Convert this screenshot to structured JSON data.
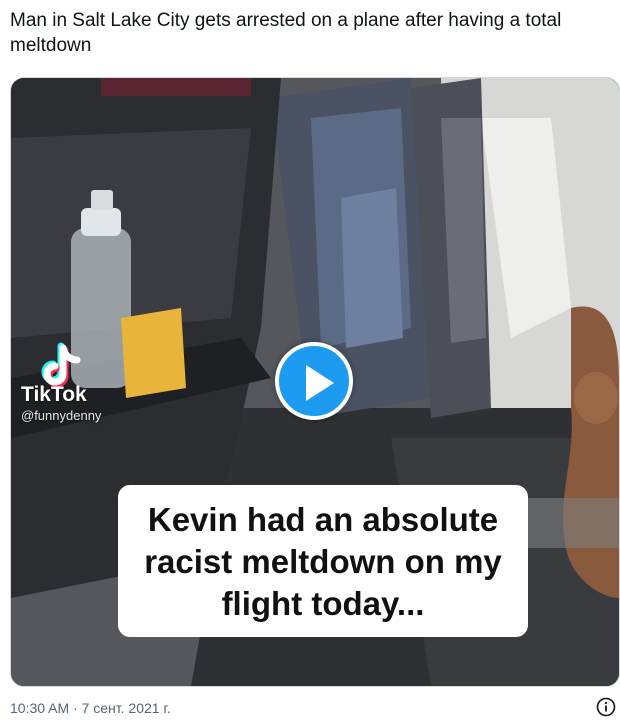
{
  "tweet": {
    "text": "Man in Salt Lake City gets arrested on a plane after having a total meltdown",
    "timestamp": "10:30 AM · 7 сент. 2021 г."
  },
  "media": {
    "type": "video",
    "play_icon": "play-icon",
    "watermark": {
      "brand": "TikTok",
      "handle": "@funnydenny",
      "logo_icon": "tiktok-logo-icon"
    },
    "caption": "Kevin had an absolute\nracist meltdown on my\nflight today..."
  },
  "info_icon": "info-icon",
  "colors": {
    "accent": "#1d9bf0",
    "text": "#0f1419",
    "muted": "#536471",
    "border": "#cfd9de"
  }
}
